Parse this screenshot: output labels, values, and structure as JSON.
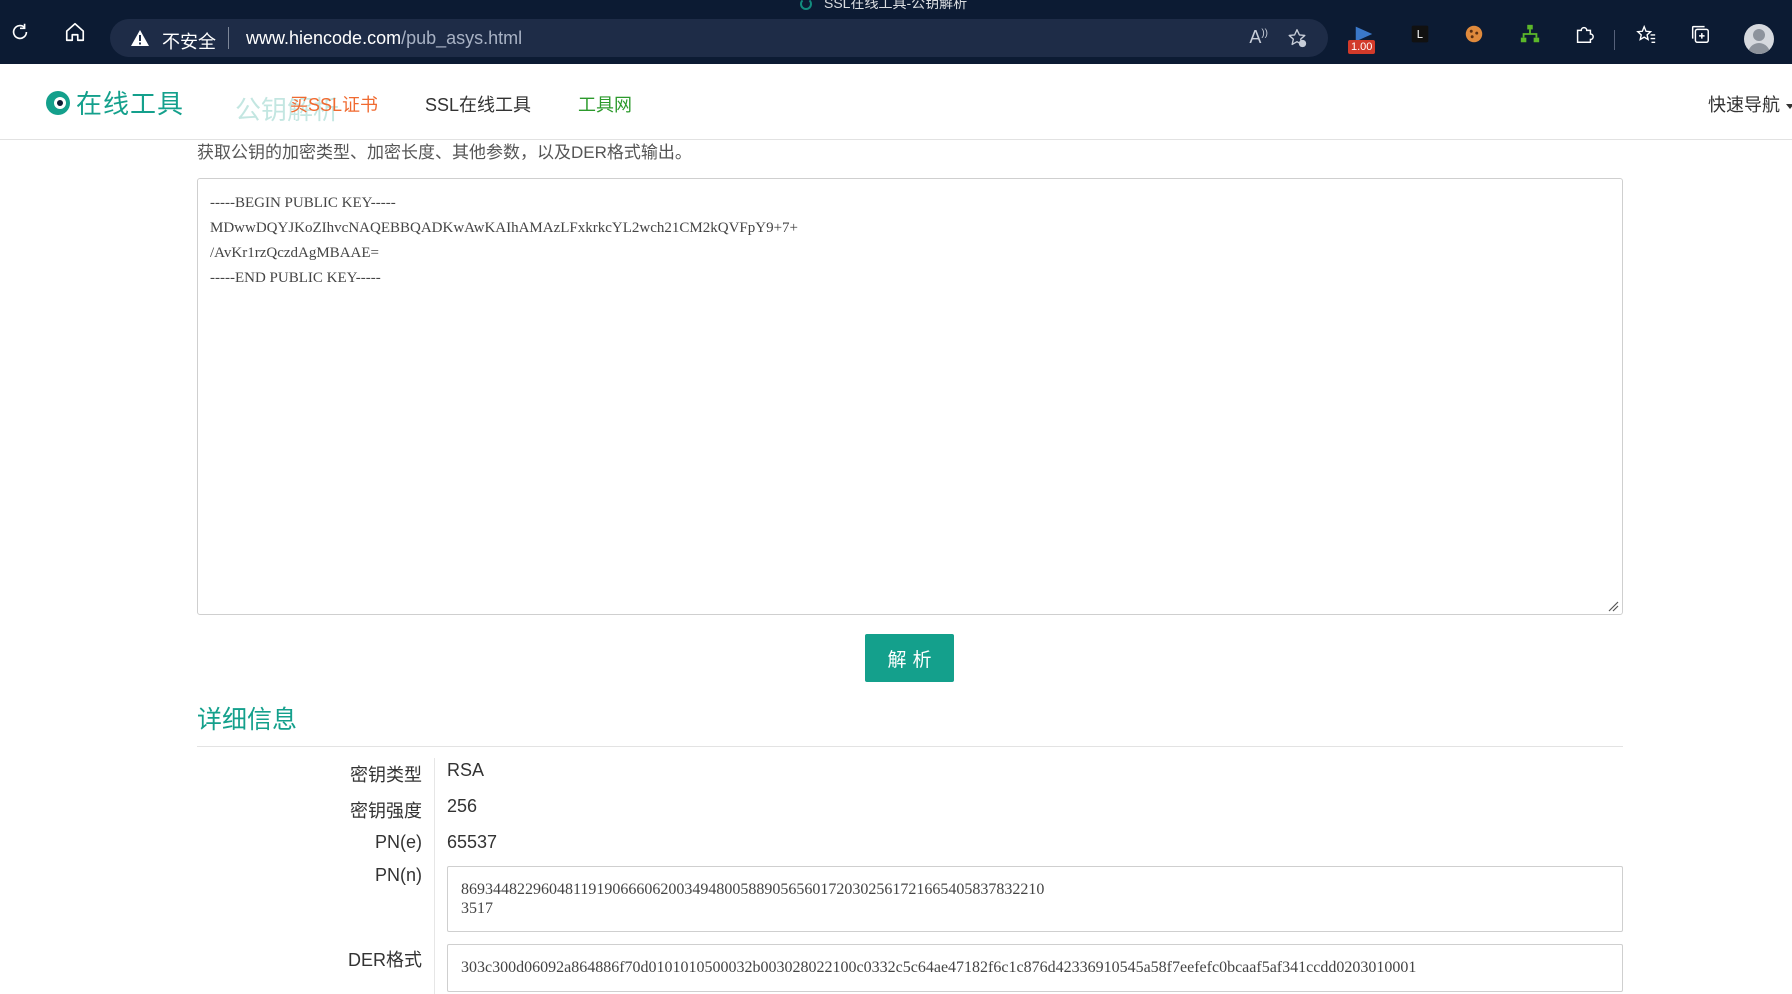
{
  "browser": {
    "tab_title": "SSL在线工具-公钥解析",
    "insecure_label": "不安全",
    "url_host": "www.hiencode.com",
    "url_path": "/pub_asys.html",
    "read_aloud_glyph": "Á",
    "extension_badge": "1.00",
    "icons": [
      "reload-icon",
      "home-icon",
      "warning-icon",
      "read-aloud-icon",
      "add-favorite-icon",
      "extension-icon",
      "extension-icon",
      "cookie-icon",
      "extension-icon",
      "puzzle-icon",
      "favorites-icon",
      "collections-icon",
      "profile-icon"
    ]
  },
  "site": {
    "logo_text": "在线工具",
    "ghost_title": "公钥解析",
    "nav": {
      "buy_ssl": "买SSL证书",
      "ssl_tools": "SSL在线工具",
      "tools_net": "工具网",
      "quick_nav": "快速导航"
    }
  },
  "main": {
    "intro": "获取公钥的加密类型、加密长度、其他参数，以及DER格式输出。",
    "key_text": "-----BEGIN PUBLIC KEY-----\nMDwwDQYJKoZIhvcNAQEBBQADKwAwKAIhAMAzLFxkrkcYL2wch21CM2kQVFpY9+7+\n/AvKr1rzQczdAgMBAAE=\n-----END PUBLIC KEY-----",
    "parse_button": "解析",
    "details_title": "详细信息",
    "details": {
      "key_type_label": "密钥类型",
      "key_type_value": "RSA",
      "key_strength_label": "密钥强度",
      "key_strength_value": "256",
      "pn_e_label": "PN(e)",
      "pn_e_value": "65537",
      "pn_n_label": "PN(n)",
      "pn_n_value": "86934482296048119190666062003494800588905656017203025617216654058378322103517",
      "der_label": "DER格式",
      "der_value": "303c300d06092a864886f70d0101010500032b003028022100c0332c5c64ae47182f6c1c876d42336910545a58f7eefefc0bcaaf5af341ccdd0203010001"
    }
  },
  "colors": {
    "chrome_bg": "#0c1b33",
    "accent": "#14a08c",
    "buy_ssl": "#f06a30",
    "tools_net": "#2c9a2c"
  }
}
